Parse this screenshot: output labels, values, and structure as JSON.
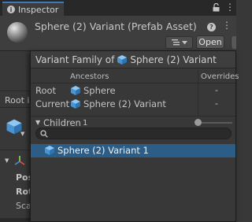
{
  "tab": {
    "title": "Inspector",
    "info_glyph": "i",
    "menu_glyph": "⋮"
  },
  "header": {
    "title": "Sphere (2) Variant (Prefab Asset)",
    "help_glyph": "?",
    "menu_glyph": "⋮",
    "open_label": "Open"
  },
  "background": {
    "root_label": "Root in",
    "rows": [
      "Pos",
      "Rot",
      "Sca"
    ]
  },
  "popup": {
    "title_prefix": "Variant Family of",
    "title_name": "Sphere (2) Variant",
    "col_ancestors": "Ancestors",
    "col_overrides": "Overrides",
    "rows": [
      {
        "label": "Root",
        "value": "Sphere",
        "overrides": "-"
      },
      {
        "label": "Current",
        "value": "Sphere (2) Variant",
        "overrides": "-"
      }
    ],
    "children_label": "Children",
    "children_count": "1",
    "search_value": "",
    "search_placeholder": "",
    "children": [
      "Sphere (2) Variant 1"
    ]
  },
  "colors": {
    "accent": "#3a79bb",
    "selection": "#2c5d87",
    "prefab_icon": "#5fa8e6"
  },
  "icons": [
    "info-icon",
    "lock-icon",
    "menu-icon",
    "help-icon",
    "prefab-cube-icon",
    "search-icon",
    "transform-axis-icon"
  ]
}
